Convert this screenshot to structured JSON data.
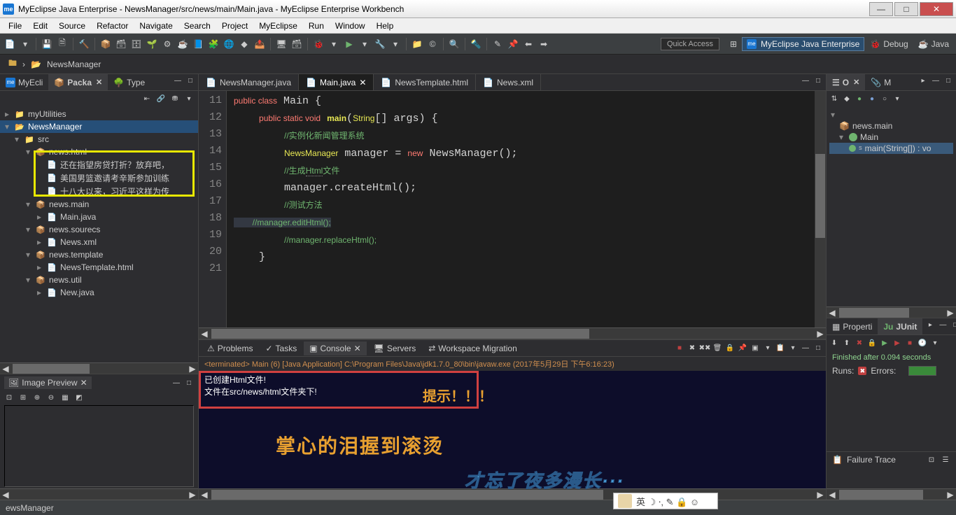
{
  "titlebar": {
    "app_icon": "me",
    "title": "MyEclipse Java Enterprise - NewsManager/src/news/main/Main.java - MyEclipse Enterprise Workbench"
  },
  "win_buttons": {
    "min": "—",
    "max": "□",
    "close": "✕"
  },
  "menu": [
    "File",
    "Edit",
    "Source",
    "Refactor",
    "Navigate",
    "Search",
    "Project",
    "MyEclipse",
    "Run",
    "Window",
    "Help"
  ],
  "quick_access": "Quick Access",
  "perspectives": {
    "active": "MyEclipse Java Enterprise",
    "debug": "Debug",
    "java": "Java"
  },
  "breadcrumb": {
    "project": "NewsManager"
  },
  "left_tabs": [
    {
      "label": "MyEcli",
      "icon": "me"
    },
    {
      "label": "Packa",
      "icon": "📦",
      "active": true
    },
    {
      "label": "Type",
      "icon": "📄"
    }
  ],
  "tree": {
    "root1": "myUtilities",
    "root2": "NewsManager",
    "src": "src",
    "pkg_html": "news.html",
    "html_files": [
      "还在指望房贷打折？放弃吧，",
      "美国男篮邀请考辛斯参加训练",
      "十八大以来，习近平这样为传"
    ],
    "pkg_main": "news.main",
    "main_java": "Main.java",
    "pkg_sources": "news.sourecs",
    "news_xml": "News.xml",
    "pkg_template": "news.template",
    "template_html": "NewsTemplate.html",
    "pkg_util": "news.util",
    "new_java": "New.java"
  },
  "image_preview": {
    "title": "Image Preview"
  },
  "editor_tabs": [
    {
      "label": "NewsManager.java",
      "icon": "J"
    },
    {
      "label": "Main.java",
      "icon": "J",
      "active": true
    },
    {
      "label": "NewsTemplate.html",
      "icon": "H"
    },
    {
      "label": "News.xml",
      "icon": "X"
    }
  ],
  "code": {
    "line_start": 11,
    "lines": [
      "",
      "    public static void main(String[] args) {",
      "        //实例化新闻管理系统",
      "        NewsManager manager = new NewsManager();",
      "        //生成Html文件",
      "        manager.createHtml();",
      "        //测试方法",
      "        //manager.editHtml();",
      "        //manager.replaceHtml();",
      "    }",
      ""
    ]
  },
  "bottom_tabs": [
    {
      "label": "Problems",
      "icon": "⚠"
    },
    {
      "label": "Tasks",
      "icon": "✓"
    },
    {
      "label": "Console",
      "icon": "▣",
      "active": true
    },
    {
      "label": "Servers",
      "icon": "🖥"
    },
    {
      "label": "Workspace Migration",
      "icon": "⇄"
    }
  ],
  "console": {
    "status": "<terminated> Main (6) [Java Application] C:\\Program Files\\Java\\jdk1.7.0_80\\bin\\javaw.exe (2017年5月29日 下午6:16:23)",
    "line1": "已创建Html文件!",
    "line2": "文件在src/news/html文件夹下!",
    "hint": "提示！！！",
    "overlay1": "掌心的泪握到滚烫",
    "overlay2": "才忘了夜多漫长···"
  },
  "outline_tabs": [
    {
      "label": "O",
      "icon": "☰",
      "active": true
    },
    {
      "label": "M",
      "icon": "📎"
    }
  ],
  "outline": {
    "pkg": "news.main",
    "class": "Main",
    "method": "main(String[]) : vo"
  },
  "right_bottom_tabs": [
    {
      "label": "Properti",
      "icon": "▦"
    },
    {
      "label": "JUnit",
      "icon": "Ju",
      "active": true
    }
  ],
  "junit": {
    "status": "Finished after 0.094 seconds",
    "runs_label": "Runs:",
    "errors_label": "Errors:",
    "failure_trace": "Failure Trace"
  },
  "statusbar": {
    "text": "ewsManager"
  },
  "ime": {
    "keys": "英 ☽ ⸱, ✎ 🔒 ☺"
  }
}
